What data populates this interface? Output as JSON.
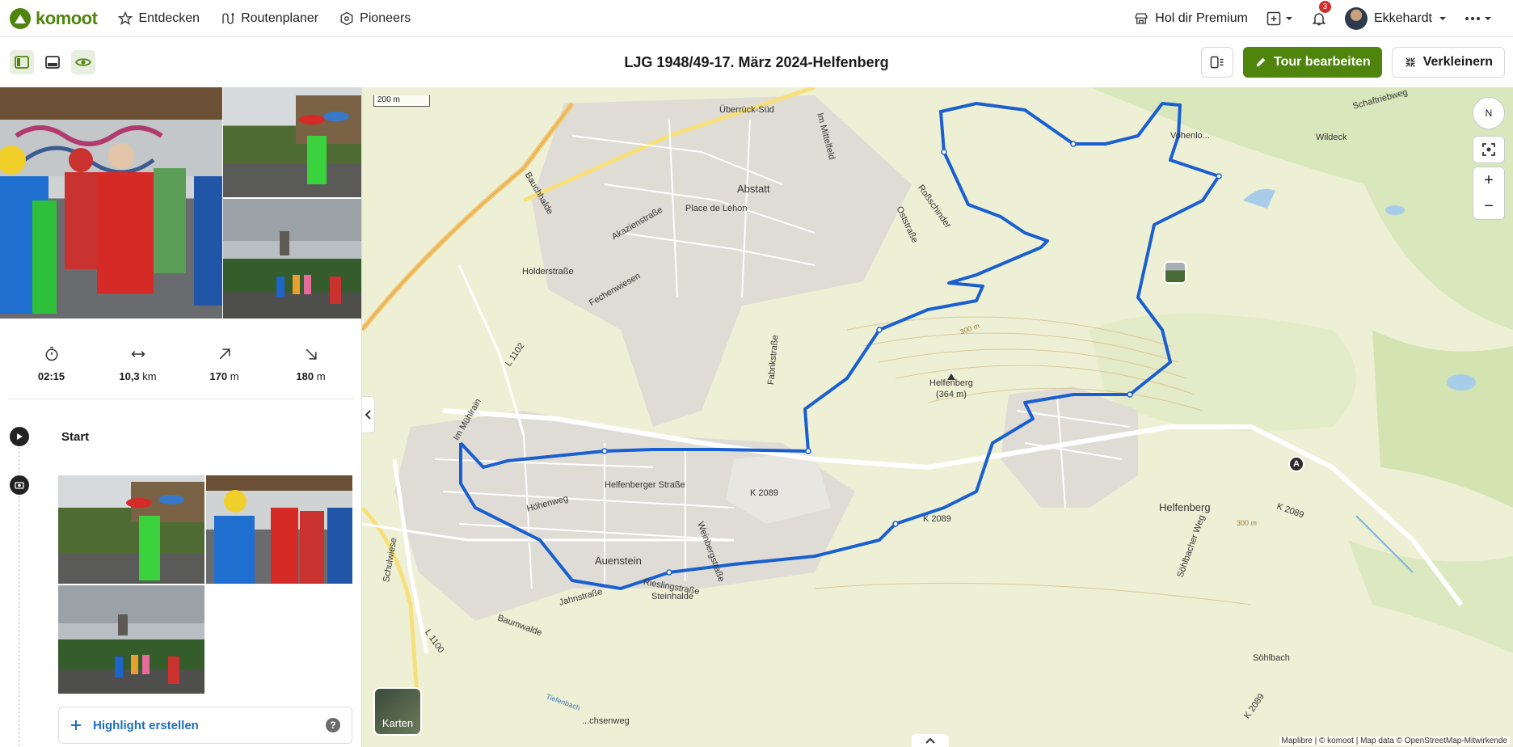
{
  "nav": {
    "brand": "komoot",
    "items": [
      {
        "label": "Entdecken",
        "icon": "star-icon"
      },
      {
        "label": "Routenplaner",
        "icon": "route-icon"
      },
      {
        "label": "Pioneers",
        "icon": "hexagon-icon"
      }
    ],
    "premium_label": "Hol dir Premium",
    "notification_count": "3",
    "user_name": "Ekkehardt"
  },
  "toolbar": {
    "tour_title": "LJG 1948/49-17. März 2024-Helfenberg",
    "edit_label": "Tour bearbeiten",
    "shrink_label": "Verkleinern"
  },
  "stats": {
    "duration": "02:15",
    "distance_value": "10,3",
    "distance_unit": "km",
    "up_value": "170",
    "up_unit": "m",
    "down_value": "180",
    "down_unit": "m"
  },
  "timeline": {
    "start_label": "Start",
    "highlight_label": "Highlight erstellen",
    "help_label": "?"
  },
  "map": {
    "scale_label": "200 m",
    "compass_label": "N",
    "zoom_in": "+",
    "zoom_out": "−",
    "layers_label": "Karten",
    "attribution": "Maplibre | © komoot | Map data © OpenStreetMap-Mitwirkende",
    "marker_label": "A",
    "labels": {
      "uberruck": "Überrück-Süd",
      "abstatt": "Abstatt",
      "place_de_lehon": "Place de Léhon",
      "akazienstrasse": "Akazienstraße",
      "bauchhalde": "Bauchhalde",
      "holderstrasse": "Holderstraße",
      "fechenwiesen": "Fechenwiesen",
      "l1102": "L 1102",
      "im_mittelfeld": "Im Mittelfeld",
      "oststrasse": "Oststraße",
      "rossschinder": "Roßschinder",
      "fabrikstrasse": "Fabrikstraße",
      "vohenlohe": "Vohenlo...",
      "wildeck": "Wildeck",
      "schaftriebweg": "Schaftriebweg",
      "helfenberg_peak": "Helfenberg",
      "helfenberg_peak_height": "(364 m)",
      "contour_300a": "300 m",
      "contour_300b": "300 m",
      "im_muhlrain": "Im Mühlrain",
      "helfenberger_strasse": "Helfenberger Straße",
      "k2089a": "K 2089",
      "k2089b": "K 2089",
      "k2089c": "K 2089",
      "k2089d": "K 2089",
      "hohenweg": "Höhenweg",
      "auenstein": "Auenstein",
      "weinbergstrasse": "Weinbergstraße",
      "rieslingstrasse": "Rieslingstraße",
      "steinhalde": "Steinhalde",
      "jahnstrasse": "Jahnstraße",
      "baumwalde": "Baumwalde",
      "schulwiese": "Schulwiese",
      "l1100": "L 1100",
      "helfenberg_village": "Helfenberg",
      "sohlbacher_weg": "Söhlbacher Weg",
      "sohlbach": "Söhlbach",
      "ochsenweg": "...chsenweg",
      "tiefenbach": "Tiefenbach"
    }
  }
}
